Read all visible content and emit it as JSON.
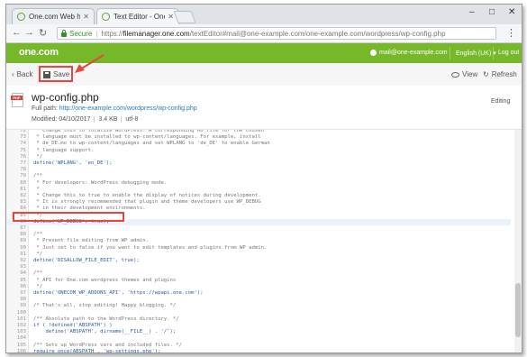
{
  "browser": {
    "tabs": [
      {
        "label": "One.com Web hosting",
        "active": false
      },
      {
        "label": "Text Editor - One.com Fi",
        "active": true
      }
    ],
    "window_controls": [
      "–",
      "□",
      "✕"
    ],
    "secure_label": "Secure",
    "url_scheme": "https://",
    "url_host": "filemanager.one.com",
    "url_rest": "/textEditor#mail@one-example.com/one-example.com/wordpress/wp-config.php"
  },
  "header": {
    "logo": "one.com",
    "user_email": "mail@one-example.com",
    "language": "English (UK) ▾",
    "logout": "Log out",
    "brand_color": "#76b82a"
  },
  "toolbar": {
    "back_label": "Back",
    "save_label": "Save",
    "view_label": "View",
    "refresh_label": "Refresh"
  },
  "file": {
    "name": "wp-config.php",
    "path_label": "Full path:",
    "path_link": "http://one-example.com/wordpress/wp-config.php",
    "modified": "Modified: 04/10/2017",
    "size": "3.4 KB",
    "encoding": "utf-8",
    "status": "Editing"
  },
  "editor": {
    "lines": [
      {
        "n": "72",
        "t": " * Change this to localize WordPress. A corresponding MO file for the chosen",
        "c": true
      },
      {
        "n": "73",
        "t": " * language must be installed to wp-content/languages. For example, install",
        "c": true
      },
      {
        "n": "74",
        "t": " * de_DE.mo to wp-content/languages and set WPLANG to 'de_DE' to enable German",
        "c": true
      },
      {
        "n": "75",
        "t": " * language support.",
        "c": true
      },
      {
        "n": "76",
        "t": " */",
        "c": true
      },
      {
        "n": "77",
        "t": "define('WPLANG', 'en_DE');",
        "c": false
      },
      {
        "n": "78",
        "t": "",
        "c": false
      },
      {
        "n": "79",
        "t": "/**",
        "c": true
      },
      {
        "n": "80",
        "t": " * For developers: WordPress debugging mode.",
        "c": true
      },
      {
        "n": "81",
        "t": " *",
        "c": true
      },
      {
        "n": "82",
        "t": " * Change this to true to enable the display of notices during development.",
        "c": true
      },
      {
        "n": "83",
        "t": " * It is strongly recommended that plugin and theme developers use WP_DEBUG",
        "c": true
      },
      {
        "n": "84",
        "t": " * in their development environments.",
        "c": true
      },
      {
        "n": "85",
        "t": " */",
        "c": true
      },
      {
        "n": "86",
        "t": "define('WP_DEBUG', true);",
        "c": false
      },
      {
        "n": "87",
        "t": "",
        "c": false
      },
      {
        "n": "88",
        "t": "/**",
        "c": true
      },
      {
        "n": "89",
        "t": " * Prevent file editing from WP admin.",
        "c": true
      },
      {
        "n": "90",
        "t": " * Just set to false if you want to edit templates and plugins from WP admin.",
        "c": true
      },
      {
        "n": "91",
        "t": " */",
        "c": true
      },
      {
        "n": "92",
        "t": "define('DISALLOW_FILE_EDIT', true);",
        "c": false
      },
      {
        "n": "93",
        "t": "",
        "c": false
      },
      {
        "n": "94",
        "t": "/**",
        "c": true
      },
      {
        "n": "95",
        "t": " * API for One.com wordpress themes and plugins",
        "c": true
      },
      {
        "n": "96",
        "t": " */",
        "c": true
      },
      {
        "n": "97",
        "t": "define('ONECOM_WP_ADDONS_API', 'https://wpapi.one.com');",
        "c": false
      },
      {
        "n": "98",
        "t": "",
        "c": false
      },
      {
        "n": "99",
        "t": "/* That's all, stop editing! Happy blogging. */",
        "c": true
      },
      {
        "n": "100",
        "t": "",
        "c": false
      },
      {
        "n": "101",
        "t": "/** Absolute path to the WordPress directory. */",
        "c": true
      },
      {
        "n": "102",
        "t": "if ( !defined('ABSPATH') )",
        "c": false
      },
      {
        "n": "103",
        "t": "    define('ABSPATH', dirname(__FILE__) . '/');",
        "c": false
      },
      {
        "n": "104",
        "t": "",
        "c": false
      },
      {
        "n": "105",
        "t": "/** Sets up WordPress vars and included files. */",
        "c": true
      },
      {
        "n": "106",
        "t": "require_once(ABSPATH . 'wp-settings.php');",
        "c": false
      },
      {
        "n": "107",
        "t": "",
        "c": false
      }
    ]
  }
}
